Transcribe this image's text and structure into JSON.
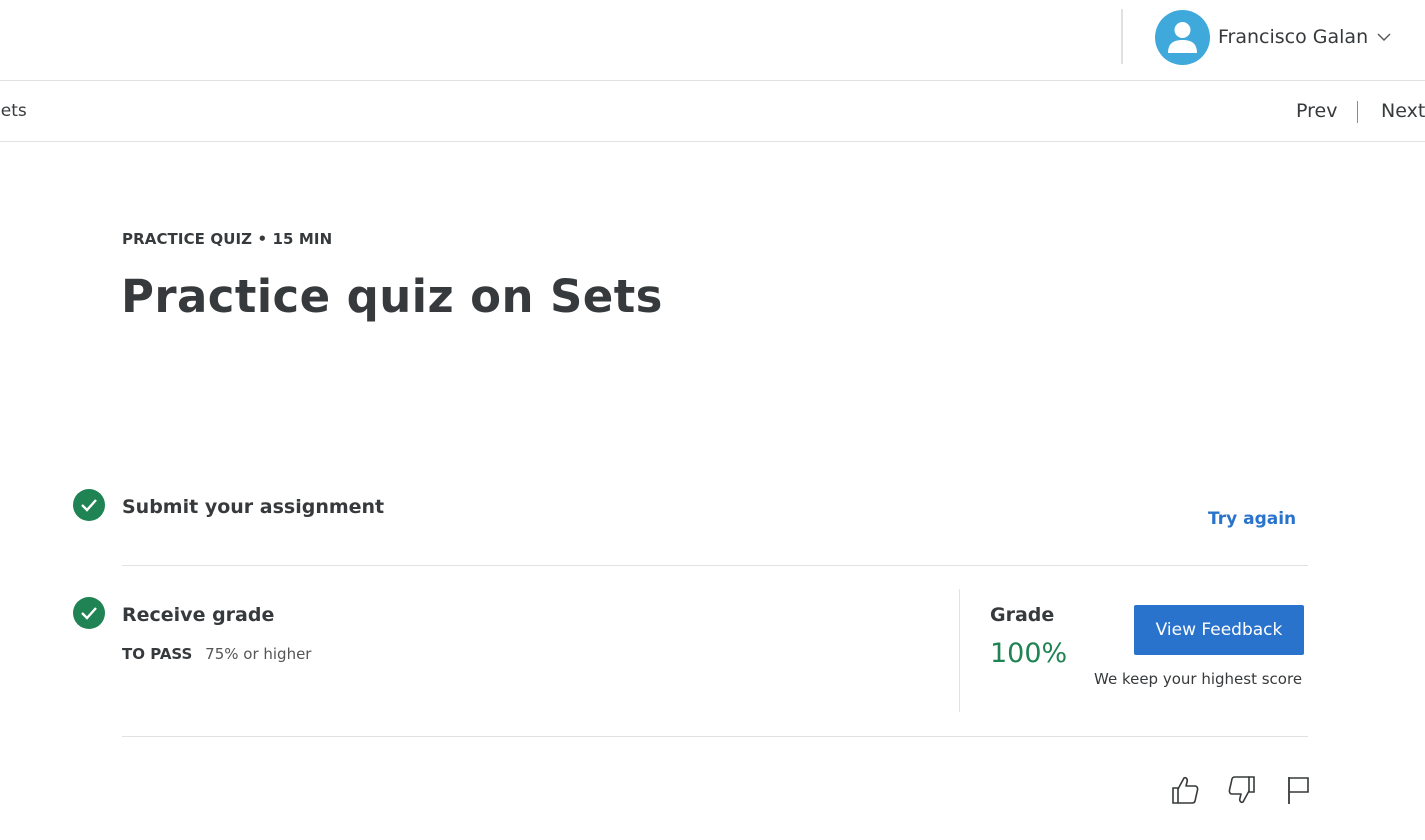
{
  "header": {
    "user_name": "Francisco Galan",
    "avatar_color": "#3fa9db"
  },
  "nav": {
    "breadcrumb": "Sets",
    "prev_label": "Prev",
    "next_label": "Next"
  },
  "item": {
    "kicker": "PRACTICE QUIZ • 15 MIN",
    "title": "Practice quiz on Sets"
  },
  "steps": {
    "submit": {
      "title": "Submit your assignment",
      "action_label": "Try again"
    },
    "grade": {
      "title": "Receive grade",
      "to_pass_label": "TO PASS",
      "to_pass_value": "75% or higher",
      "grade_label": "Grade",
      "grade_value": "100%",
      "button_label": "View Feedback",
      "note": "We keep your highest score"
    }
  },
  "colors": {
    "accent": "#2a73cc",
    "success": "#1f8354",
    "text": "#373a3c"
  },
  "icons": [
    "chevron-down-icon",
    "user-avatar-icon",
    "check-circle-icon",
    "thumbs-up-icon",
    "thumbs-down-icon",
    "flag-icon"
  ]
}
